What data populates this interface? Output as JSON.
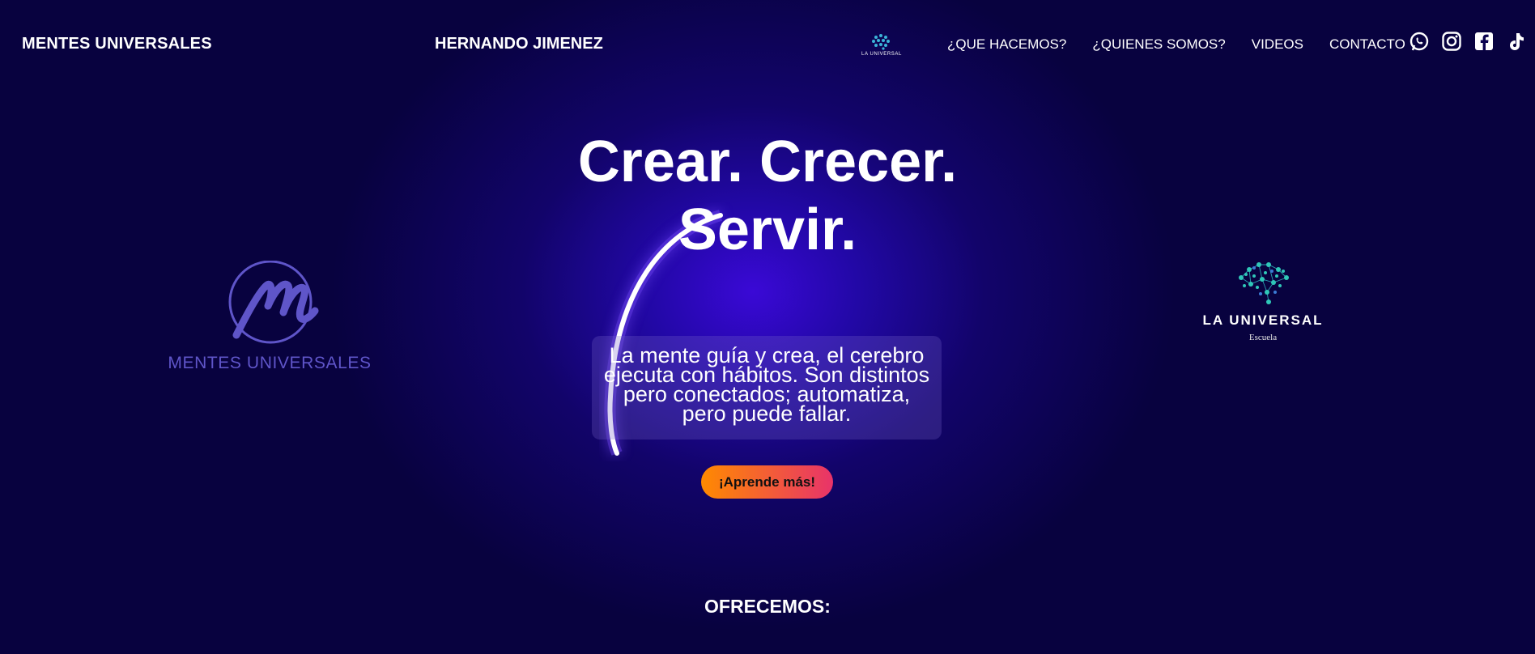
{
  "header": {
    "brand_left": "MENTES UNIVERSALES",
    "brand_mid": "HERNANDO JIMENEZ",
    "mini_logo_text": "LA UNIVERSAL",
    "nav": [
      "¿QUE HACEMOS?",
      "¿QUIENES SOMOS?",
      "VIDEOS",
      "CONTACTO"
    ],
    "social_icons": [
      "whatsapp-icon",
      "instagram-icon",
      "facebook-icon",
      "tiktok-icon"
    ]
  },
  "hero": {
    "title_line1": "Crear. Crecer.",
    "title_line2": "Servir.",
    "subtitle": "La mente guía y crea, el cerebro ejecuta con hábitos. Son distintos pero conectados; automatiza, pero puede fallar.",
    "cta": "¡Aprende más!"
  },
  "logos": {
    "left_text": "MENTES UNIVERSALES",
    "right_name": "LA UNIVERSAL",
    "right_sub": "Escuela"
  },
  "section": {
    "offer_title": "OFRECEMOS:"
  },
  "colors": {
    "background": "#08023f",
    "glow": "#3a09d6",
    "cta_start": "#ff8a00",
    "cta_end": "#e8336a",
    "logo_left": "#5f55c9",
    "logo_right": "#2fc7b8"
  }
}
